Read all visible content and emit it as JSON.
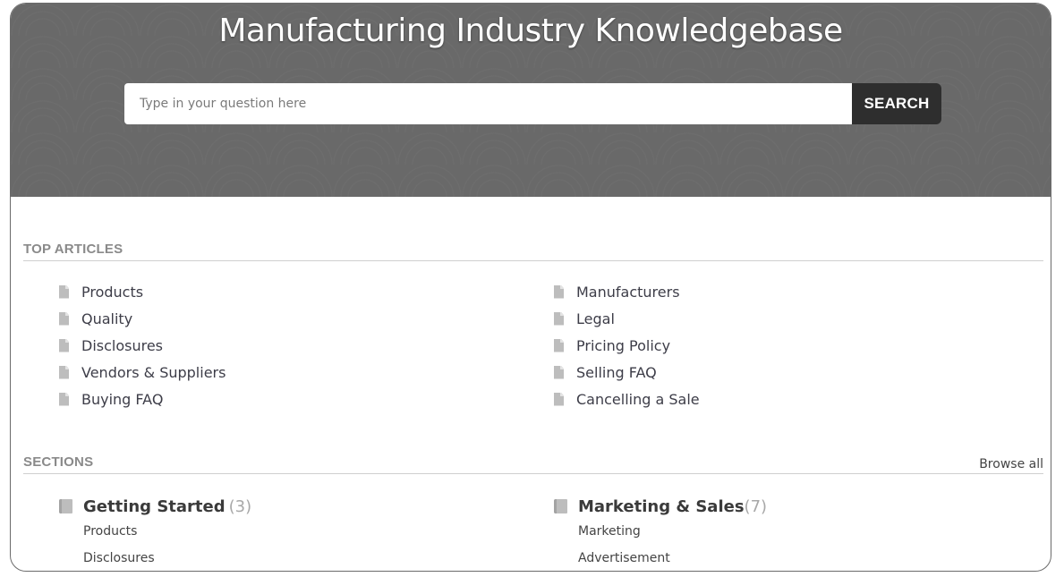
{
  "hero": {
    "title": "Manufacturing Industry Knowledgebase",
    "search_placeholder": "Type in your question here",
    "search_value": "",
    "search_button_label": "SEARCH",
    "background_color": "#696969",
    "button_color": "#2e2e2e"
  },
  "top_articles": {
    "heading": "TOP ARTICLES",
    "icon": "document-icon",
    "left": [
      {
        "label": "Products"
      },
      {
        "label": "Quality"
      },
      {
        "label": "Disclosures"
      },
      {
        "label": "Vendors & Suppliers"
      },
      {
        "label": "Buying FAQ"
      }
    ],
    "right": [
      {
        "label": "Manufacturers"
      },
      {
        "label": "Legal"
      },
      {
        "label": "Pricing Policy"
      },
      {
        "label": "Selling FAQ"
      },
      {
        "label": "Cancelling a Sale"
      }
    ]
  },
  "sections": {
    "heading": "SECTIONS",
    "browse_all_label": "Browse all",
    "icon": "book-icon",
    "items": [
      {
        "title": "Getting Started",
        "count": "(3)",
        "articles": [
          "Products",
          "Disclosures"
        ]
      },
      {
        "title": "Marketing & Sales",
        "count": "(7)",
        "articles": [
          "Marketing",
          "Advertisement"
        ]
      }
    ]
  }
}
